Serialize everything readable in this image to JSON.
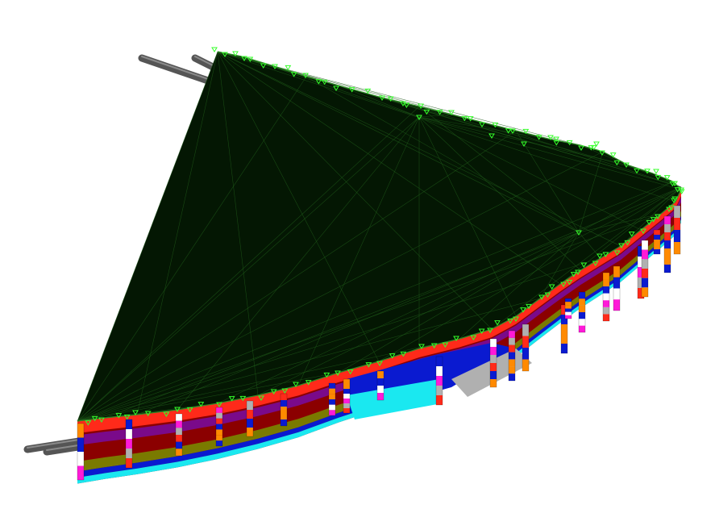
{
  "scene": {
    "background": "#ffffff",
    "surface_color": "#041703",
    "triangulation_color": "#1f5a1a",
    "survey_marker_color": "#35ff2a",
    "pipe_color": "#555555",
    "strata_colors": [
      "#8b0000",
      "#ff2a1a",
      "#7a0a8a",
      "#0a1ad0",
      "#1ae8f0",
      "#ff8a00",
      "#ff1ad8",
      "#b0b0b0",
      "#ffffff",
      "#7a7a00",
      "#1a7ad0"
    ],
    "description_icons": [
      "survey-marker-icon",
      "pipe-icon"
    ]
  }
}
